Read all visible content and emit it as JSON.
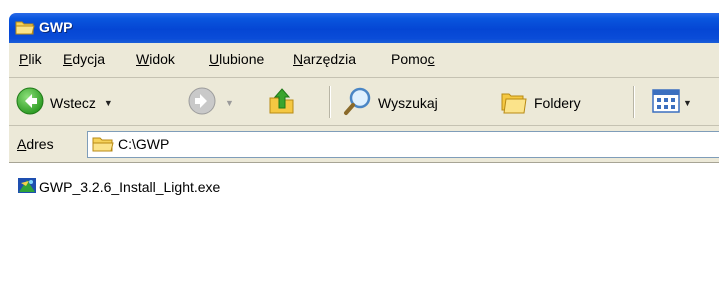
{
  "window": {
    "title": "GWP"
  },
  "menu": {
    "items": [
      {
        "first": "P",
        "rest": "lik"
      },
      {
        "first": "E",
        "rest": "dycja"
      },
      {
        "first": "W",
        "rest": "idok"
      },
      {
        "first": "U",
        "rest": "lubione"
      },
      {
        "first": "N",
        "rest": "arzędzia"
      },
      {
        "first": "Pomo",
        "rest": "c"
      }
    ]
  },
  "toolbar": {
    "back_label": "Wstecz",
    "search_label": "Wyszukaj",
    "folders_label": "Foldery",
    "icons": [
      "back-arrow-icon",
      "forward-arrow-icon",
      "up-folder-icon",
      "search-magnifier-icon",
      "folders-icon",
      "views-icon"
    ]
  },
  "address": {
    "label_first": "A",
    "label_rest": "dres",
    "value": "C:\\GWP"
  },
  "files": [
    {
      "name": "GWP_3.2.6_Install_Light.exe",
      "icon": "exe-installer-icon"
    }
  ],
  "colors": {
    "titlebar": "#0546d4",
    "chrome": "#ece9d8",
    "back_green": "#3aa52e",
    "folder_yellow": "#f5c842"
  }
}
